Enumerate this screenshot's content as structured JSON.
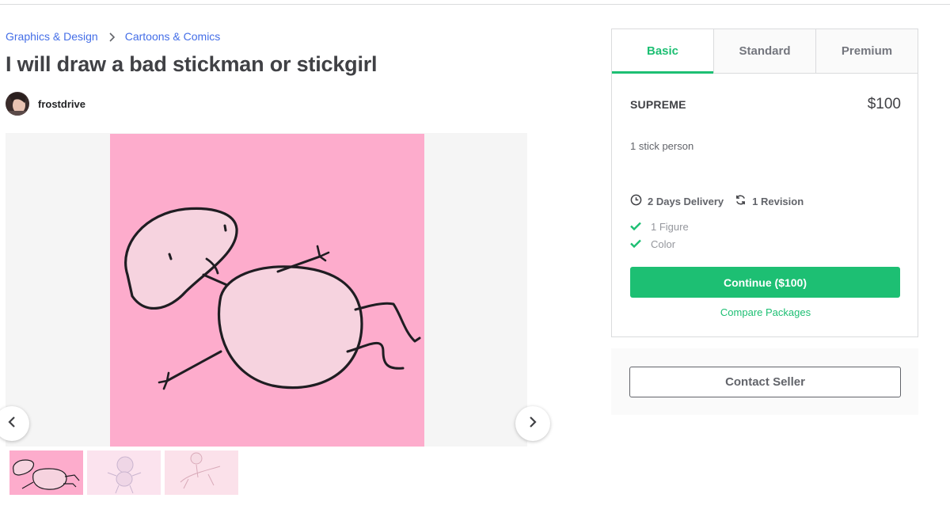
{
  "breadcrumb": {
    "category": "Graphics & Design",
    "subcategory": "Cartoons & Comics"
  },
  "gig": {
    "title": "I will draw a bad stickman or stickgirl",
    "seller_name": "frostdrive"
  },
  "gallery": {
    "thumbnail_count": 3,
    "active_index": 0
  },
  "packages": {
    "tabs": [
      "Basic",
      "Standard",
      "Premium"
    ],
    "active_tab": "Basic",
    "name": "SUPREME",
    "price": "$100",
    "description": "1 stick person",
    "delivery": "2 Days Delivery",
    "revisions": "1 Revision",
    "features": [
      "1 Figure",
      "Color"
    ],
    "continue_label": "Continue ($100)",
    "compare_label": "Compare Packages"
  },
  "contact": {
    "label": "Contact Seller"
  },
  "colors": {
    "accent_green": "#1dbf73",
    "link_blue": "#446ee7",
    "image_pink": "#fdaccc",
    "text_dark": "#404145"
  }
}
